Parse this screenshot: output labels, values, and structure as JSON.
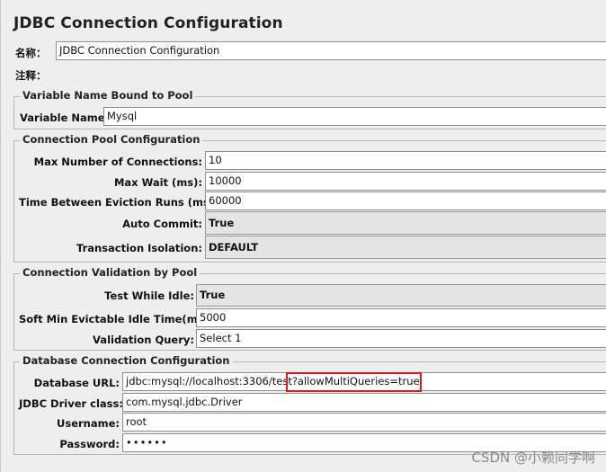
{
  "title": "JDBC Connection Configuration",
  "name_label": "名称：",
  "name_value": "JDBC Connection Configuration",
  "comment_label": "注释：",
  "comment_value": "",
  "variable_group": {
    "legend": "Variable Name Bound to Pool",
    "var_label": "Variable Name:",
    "var_value": "Mysql"
  },
  "pool_group": {
    "legend": "Connection Pool Configuration",
    "max_conn_label": "Max Number of Connections:",
    "max_conn_value": "10",
    "max_wait_label": "Max Wait (ms):",
    "max_wait_value": "10000",
    "eviction_label": "Time Between Eviction Runs (ms):",
    "eviction_value": "60000",
    "autocommit_label": "Auto Commit:",
    "autocommit_value": "True",
    "isolation_label": "Transaction Isolation:",
    "isolation_value": "DEFAULT"
  },
  "validation_group": {
    "legend": "Connection Validation by Pool",
    "test_idle_label": "Test While Idle:",
    "test_idle_value": "True",
    "soft_min_label": "Soft Min Evictable Idle Time(ms):",
    "soft_min_value": "5000",
    "query_label": "Validation Query:",
    "query_value": "Select 1"
  },
  "db_group": {
    "legend": "Database Connection Configuration",
    "url_label": "Database URL:",
    "url_value": "jdbc:mysql://localhost:3306/test?allowMultiQueries=true",
    "driver_label": "JDBC Driver class:",
    "driver_value": "com.mysql.jdbc.Driver",
    "username_label": "Username:",
    "username_value": "root",
    "password_label": "Password:",
    "password_value": "••••••"
  },
  "watermark": "CSDN @小赖同学啊",
  "colors": {
    "highlight": "#e01818"
  }
}
